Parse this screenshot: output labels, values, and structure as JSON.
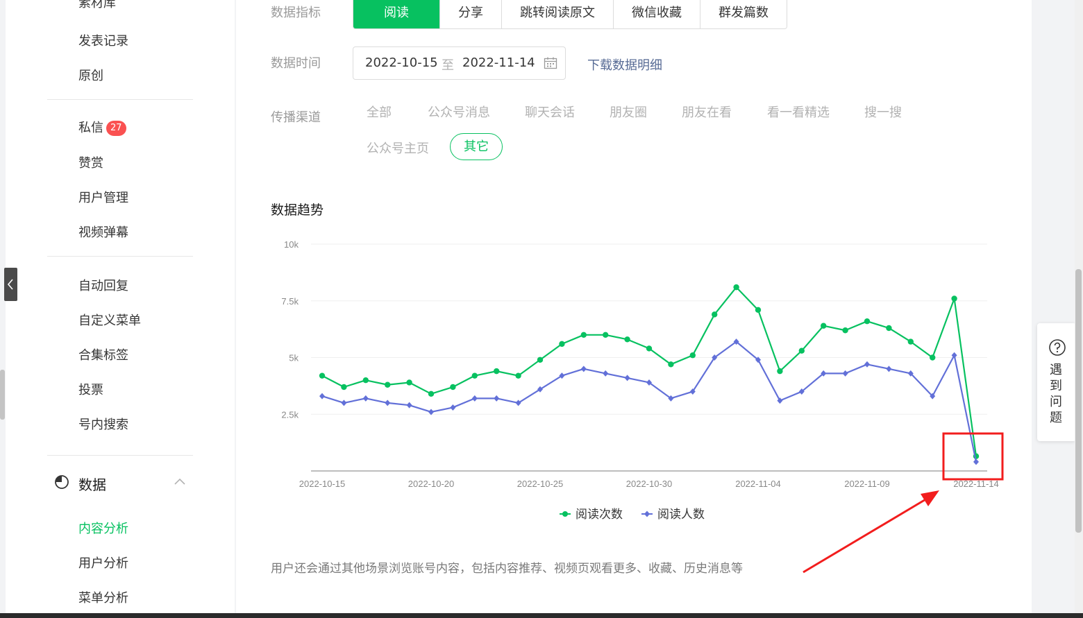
{
  "sidebar": {
    "partial_top_label": "素材库",
    "items_group1": [
      "发表记录",
      "原创"
    ],
    "private_msg": {
      "label": "私信",
      "badge": "27"
    },
    "items_group2": [
      "赞赏",
      "用户管理",
      "视频弹幕"
    ],
    "items_group3": [
      "自动回复",
      "自定义菜单",
      "合集标签",
      "投票",
      "号内搜索"
    ],
    "data_section": {
      "title": "数据",
      "items": [
        "内容分析",
        "用户分析",
        "菜单分析"
      ],
      "active_item": "内容分析"
    }
  },
  "filters": {
    "metric_label": "数据指标",
    "metric_tabs": [
      "阅读",
      "分享",
      "跳转阅读原文",
      "微信收藏",
      "群发篇数"
    ],
    "active_metric": "阅读",
    "time_label": "数据时间",
    "date_start": "2022-10-15",
    "date_sep": "至",
    "date_end": "2022-11-14",
    "download_link": "下载数据明细",
    "channel_label": "传播渠道",
    "channels": [
      "全部",
      "公众号消息",
      "聊天会话",
      "朋友圈",
      "朋友在看",
      "看一看精选",
      "搜一搜",
      "公众号主页",
      "其它"
    ],
    "active_channel": "其它"
  },
  "chart_title": "数据趋势",
  "chart_data": {
    "type": "line",
    "title": "",
    "xlabel": "",
    "ylabel": "",
    "ylim": [
      0,
      10000
    ],
    "y_ticks": [
      "10k",
      "7.5k",
      "5k",
      "2.5k"
    ],
    "y_tick_values": [
      10000,
      7500,
      5000,
      2500
    ],
    "x": [
      "2022-10-15",
      "2022-10-16",
      "2022-10-17",
      "2022-10-18",
      "2022-10-19",
      "2022-10-20",
      "2022-10-21",
      "2022-10-22",
      "2022-10-23",
      "2022-10-24",
      "2022-10-25",
      "2022-10-26",
      "2022-10-27",
      "2022-10-28",
      "2022-10-29",
      "2022-10-30",
      "2022-10-31",
      "2022-11-01",
      "2022-11-02",
      "2022-11-03",
      "2022-11-04",
      "2022-11-05",
      "2022-11-06",
      "2022-11-07",
      "2022-11-08",
      "2022-11-09",
      "2022-11-10",
      "2022-11-11",
      "2022-11-12",
      "2022-11-13",
      "2022-11-14"
    ],
    "x_tick_labels": [
      "2022-10-15",
      "2022-10-20",
      "2022-10-25",
      "2022-10-30",
      "2022-11-04",
      "2022-11-09",
      "2022-11-14"
    ],
    "series": [
      {
        "name": "阅读次数",
        "color": "#07c160",
        "marker": "circle",
        "values": [
          4200,
          3700,
          4000,
          3800,
          3900,
          3400,
          3700,
          4200,
          4400,
          4200,
          4900,
          5600,
          6000,
          6000,
          5800,
          5400,
          4700,
          5100,
          6900,
          8100,
          7100,
          4400,
          5300,
          6400,
          6200,
          6600,
          6300,
          5700,
          5000,
          7600,
          650
        ]
      },
      {
        "name": "阅读人数",
        "color": "#6270d8",
        "marker": "diamond",
        "values": [
          3300,
          3000,
          3200,
          3000,
          2900,
          2600,
          2800,
          3200,
          3200,
          3000,
          3600,
          4200,
          4500,
          4300,
          4100,
          3900,
          3200,
          3500,
          5000,
          5700,
          4900,
          3100,
          3500,
          4300,
          4300,
          4700,
          4500,
          4300,
          3300,
          5100,
          400
        ]
      }
    ],
    "legend_position": "bottom-center",
    "grid": true
  },
  "footnote": "用户还会通过其他场景浏览账号内容，包括内容推荐、视频页观看更多、收藏、历史消息等",
  "help_float": {
    "label": "遇到问题"
  },
  "annotation_colors": {
    "highlight": "#f21d1d"
  }
}
